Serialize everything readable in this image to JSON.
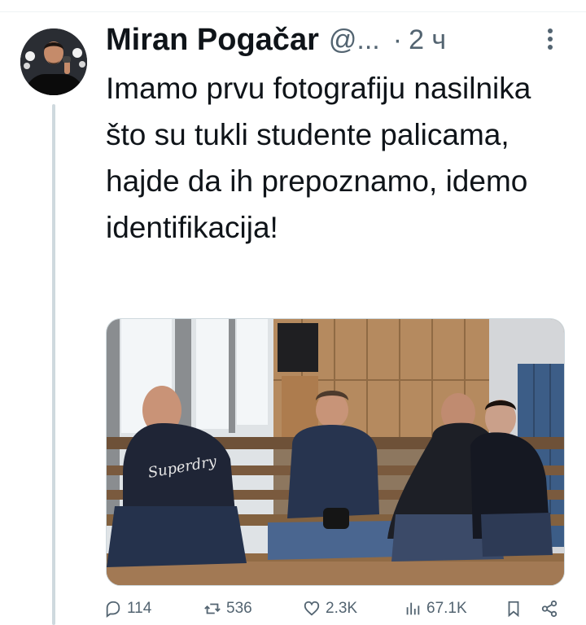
{
  "tweet": {
    "author_name": "Miran Pogačar",
    "author_handle": "@...",
    "separator": "·",
    "time": "2 ч",
    "text": "Imamo prvu fotografiju nasilnika što su tukli studente palicama, hajde da ih prepoznamo, idemo identifikacija!",
    "media_shirt_text": "Superdry"
  },
  "actions": {
    "replies": "114",
    "reposts": "536",
    "likes": "2.3K",
    "views": "67.1K"
  },
  "colors": {
    "text": "#0f1419",
    "secondary": "#536471",
    "thread_line": "#cfd9de"
  },
  "icons": [
    "more-icon",
    "reply-icon",
    "repost-icon",
    "like-icon",
    "views-icon",
    "bookmark-icon",
    "share-icon"
  ]
}
